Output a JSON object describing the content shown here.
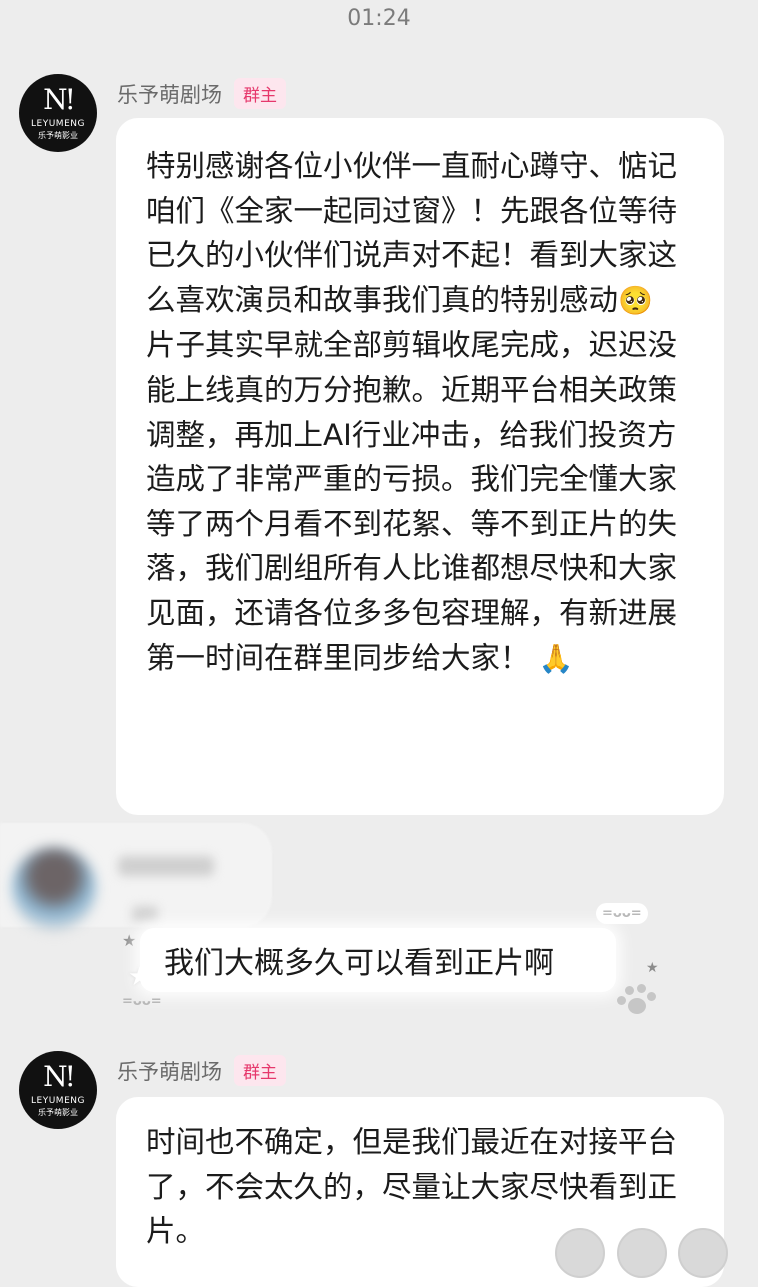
{
  "status_time": "01:24",
  "group_owner": {
    "avatar_logo_en": "LEYUMENG",
    "avatar_logo_cn": "乐予萌影业",
    "avatar_glyph": "N!",
    "name": "乐予萌剧场",
    "badge": "群主",
    "badge_color": "#e6386c"
  },
  "messages": [
    {
      "text_part1": "特别感谢各位小伙伴一直耐心蹲守、惦记咱们《全家一起同过窗》！先跟各位等待已久的小伙伴们说声对不起！看到大家这么喜欢演员和故事我们真的特别感动",
      "emoji_1": "🥺",
      "text_part2": "\n片子其实早就全部剪辑收尾完成，迟迟没能上线真的万分抱歉。近期平台相关政策调整，再加上AI行业冲击，给我们投资方造成了非常严重的亏损。我们完全懂大家等了两个月看不到花絮、等不到正片的失落，我们剧组所有人比谁都想尽快和大家见面，还请各位多多包容理解，有新进展第一时间在群里同步给大家！",
      "emoji_2": "🙏"
    },
    {
      "text": "时间也不确定，但是我们最近在对接平台了，不会太久的，尽量让大家尽快看到正片。"
    }
  ],
  "user_message": {
    "text": "我们大概多久可以看到正片啊",
    "kaomoji": "=ᴗᴗ="
  }
}
